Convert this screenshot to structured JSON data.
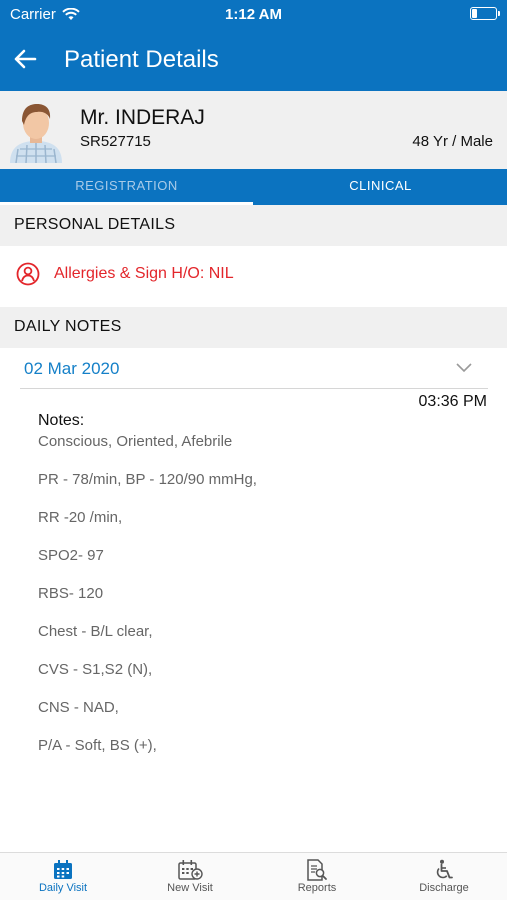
{
  "status_bar": {
    "carrier": "Carrier",
    "time": "1:12 AM"
  },
  "header": {
    "title": "Patient Details"
  },
  "patient": {
    "name": "Mr. INDERAJ",
    "id": "SR527715",
    "age_gender": "48 Yr  / Male"
  },
  "tabs": [
    {
      "label": "REGISTRATION",
      "active": false
    },
    {
      "label": "CLINICAL",
      "active": true
    }
  ],
  "personal_details": {
    "title": "PERSONAL DETAILS",
    "allergy": "Allergies & Sign H/O: NIL",
    "allergy_color": "#e3262b"
  },
  "daily_notes": {
    "title": "DAILY NOTES",
    "date": "02 Mar 2020",
    "time": "03:36 PM",
    "notes_label": "Notes:",
    "lines": [
      "Conscious, Oriented, Afebrile",
      "PR - 78/min, BP - 120/90 mmHg,",
      "RR -20 /min,",
      "SPO2- 97",
      "RBS- 120",
      "Chest - B/L clear,",
      "CVS - S1,S2 (N),",
      "CNS - NAD,",
      "P/A - Soft, BS (+),"
    ]
  },
  "tab_bar": [
    {
      "label": "Daily Visit",
      "icon": "calendar-icon",
      "active": true
    },
    {
      "label": "New Visit",
      "icon": "calendar-add-icon",
      "active": false
    },
    {
      "label": "Reports",
      "icon": "report-search-icon",
      "active": false
    },
    {
      "label": "Discharge",
      "icon": "wheelchair-icon",
      "active": false
    }
  ],
  "colors": {
    "primary": "#0b73c0",
    "date": "#1580c8"
  }
}
